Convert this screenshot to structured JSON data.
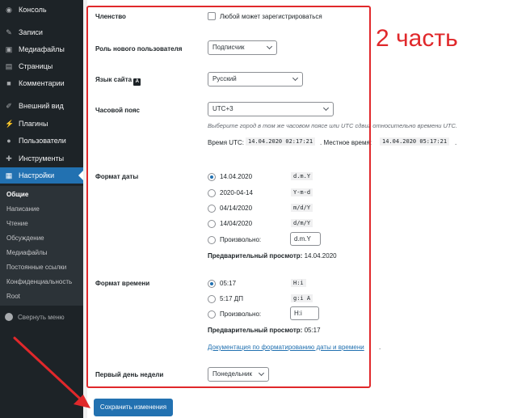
{
  "sidebar": {
    "items": [
      {
        "label": "Консоль",
        "icon": "dashboard-icon"
      },
      {
        "label": "Записи",
        "icon": "pin-icon"
      },
      {
        "label": "Медиафайлы",
        "icon": "media-icon"
      },
      {
        "label": "Страницы",
        "icon": "pages-icon"
      },
      {
        "label": "Комментарии",
        "icon": "comments-icon"
      },
      {
        "label": "Внешний вид",
        "icon": "brush-icon"
      },
      {
        "label": "Плагины",
        "icon": "plugin-icon"
      },
      {
        "label": "Пользователи",
        "icon": "users-icon"
      },
      {
        "label": "Инструменты",
        "icon": "tools-icon"
      },
      {
        "label": "Настройки",
        "icon": "settings-icon"
      }
    ],
    "submenu": [
      "Общие",
      "Написание",
      "Чтение",
      "Обсуждение",
      "Медиафайлы",
      "Постоянные ссылки",
      "Конфиденциальность",
      "Root"
    ],
    "collapse_label": "Свернуть меню"
  },
  "settings": {
    "membership": {
      "label": "Членство",
      "checkbox_label": "Любой может зарегистрироваться",
      "checked": false
    },
    "default_role": {
      "label": "Роль нового пользователя",
      "value": "Подписчик"
    },
    "site_language": {
      "label": "Язык сайта",
      "value": "Русский"
    },
    "timezone": {
      "label": "Часовой пояс",
      "value": "UTC+3",
      "description": "Выберите город в том же часовом поясе или UTC сдвиг относительно времени UTC.",
      "utc_label": "Время UTC:",
      "utc_value": "14.04.2020 02:17:21",
      "local_label": ". Местное время:",
      "local_value": "14.04.2020 05:17:21",
      "end": "."
    },
    "date_format": {
      "label": "Формат даты",
      "options": [
        {
          "text": "14.04.2020",
          "code": "d.m.Y",
          "selected": true
        },
        {
          "text": "2020-04-14",
          "code": "Y-m-d",
          "selected": false
        },
        {
          "text": "04/14/2020",
          "code": "m/d/Y",
          "selected": false
        },
        {
          "text": "14/04/2020",
          "code": "d/m/Y",
          "selected": false
        }
      ],
      "custom_label": "Произвольно:",
      "custom_value": "d.m.Y",
      "preview_label": "Предварительный просмотр:",
      "preview_value": "14.04.2020"
    },
    "time_format": {
      "label": "Формат времени",
      "options": [
        {
          "text": "05:17",
          "code": "H:i",
          "selected": true
        },
        {
          "text": "5:17 ДП",
          "code": "g:i A",
          "selected": false
        }
      ],
      "custom_label": "Произвольно:",
      "custom_value": "H:i",
      "preview_label": "Предварительный просмотр:",
      "preview_value": "05:17",
      "doc_link": "Документация по форматированию даты и времени",
      "doc_link_end": "."
    },
    "week_start": {
      "label": "Первый день недели",
      "value": "Понедельник"
    }
  },
  "save_button": "Сохранить изменения",
  "annotation": "2 часть",
  "colors": {
    "accent": "#2271b1",
    "annotation_red": "#e0282b",
    "sidebar_bg": "#1d2327"
  }
}
